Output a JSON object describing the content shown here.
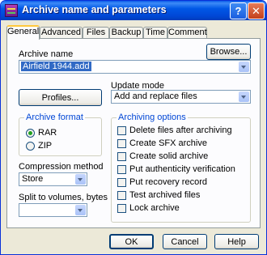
{
  "window": {
    "title": "Archive name and parameters",
    "help_button": "?",
    "close_button": "✕"
  },
  "tabs": [
    "General",
    "Advanced",
    "Files",
    "Backup",
    "Time",
    "Comment"
  ],
  "general": {
    "archive_name_label": "Archive name",
    "browse_button": "Browse...",
    "archive_name_value": "Airfield 1944.add",
    "profiles_button": "Profiles...",
    "update_mode_label": "Update mode",
    "update_mode_value": "Add and replace files",
    "archive_format": {
      "legend": "Archive format",
      "options": [
        "RAR",
        "ZIP"
      ],
      "selected": "RAR"
    },
    "archiving_options": {
      "legend": "Archiving options",
      "items": [
        "Delete files after archiving",
        "Create SFX archive",
        "Create solid archive",
        "Put authenticity verification",
        "Put recovery record",
        "Test archived files",
        "Lock archive"
      ]
    },
    "compression_method_label": "Compression method",
    "compression_method_value": "Store",
    "split_label": "Split to volumes, bytes",
    "split_value": ""
  },
  "footer": {
    "ok": "OK",
    "cancel": "Cancel",
    "help": "Help"
  },
  "colors": {
    "titlebar": "#0054e3",
    "tab_active_accent": "#ffc83c",
    "group_legend": "#0046d5",
    "selection": "#316ac5"
  }
}
